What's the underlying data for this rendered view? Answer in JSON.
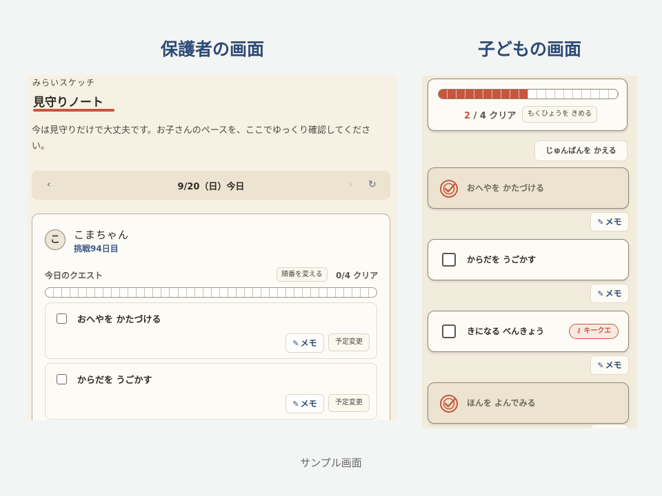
{
  "headings": {
    "parent": "保護者の画面",
    "child": "子どもの画面"
  },
  "caption": "サンプル画面",
  "parent": {
    "brand": "みらいスケッチ",
    "title": "見守りノート",
    "description": "今は見守りだけで大丈夫です。お子さんのペースを、ここでゆっくり確認してください。",
    "date_nav": {
      "prev": "‹",
      "date": "9/20（日）今日",
      "next": "›",
      "refresh": "↻"
    },
    "profile": {
      "avatar": "こ",
      "name": "こまちゃん",
      "days": "挑戦94日目"
    },
    "quest": {
      "label": "今日のクエスト",
      "reorder": "順番を変える",
      "count": "0/4 クリア",
      "progress": 0
    },
    "tasks": [
      {
        "name": "おへやを かたづける",
        "memo": "メモ",
        "reschedule": "予定変更",
        "checked": false
      },
      {
        "name": "からだを うごかす",
        "memo": "メモ",
        "reschedule": "予定変更",
        "checked": false
      }
    ]
  },
  "child": {
    "progress": {
      "done": "2",
      "rest": " / 4 クリア",
      "fraction": 0.5
    },
    "goal_button": "もくひょうを きめる",
    "order_button": "じゅんばんを かえる",
    "memo_label": "メモ",
    "tasks": [
      {
        "name": "おへやを かたづける",
        "done": true
      },
      {
        "name": "からだを うごかす",
        "done": false
      },
      {
        "name": "きになる べんきょう",
        "done": false,
        "badge": "キークエ"
      },
      {
        "name": "ほんを よんでみる",
        "done": true
      }
    ]
  },
  "colors": {
    "accent": "#c9553a",
    "navy": "#2c4a74",
    "paper": "#f7f1e4"
  },
  "icons": {
    "checkbox": "checkbox-icon",
    "done": "check-circle-icon",
    "pencil": "pencil-icon",
    "key": "key-icon"
  }
}
